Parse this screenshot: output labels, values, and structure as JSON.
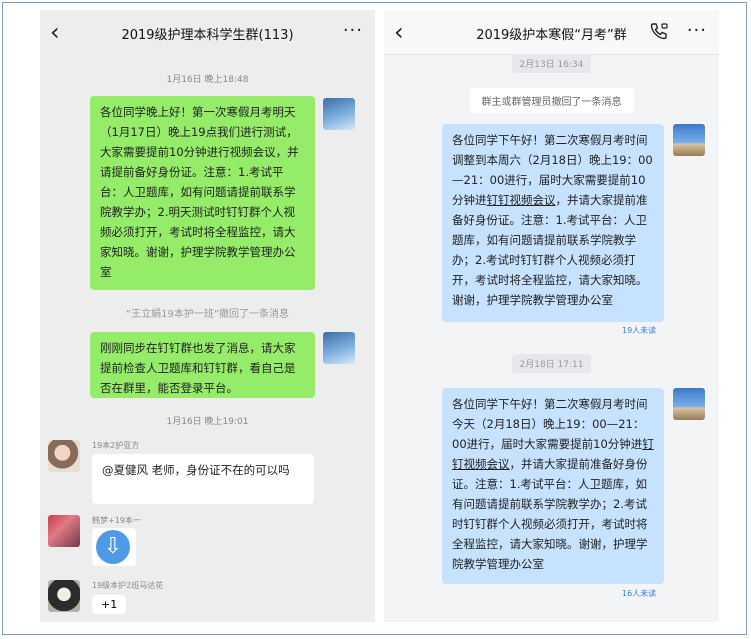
{
  "left": {
    "title": "2019级护理本科学生群(113)",
    "time1": "1月16日 晚上18:48",
    "msg1": "各位同学晚上好！第一次寒假月考明天（1月17日）晚上19点我们进行测试，大家需要提前10分钟进行视频会议，并请提前备好身份证。注意：1.考试平台：人卫题库，如有问题请提前联系学院教学办；2.明天测试时钉钉群个人视频必须打开，考试时将全程监控，请大家知晓。谢谢，护理学院教学管理办公室",
    "recall": "“王立娟19本护一班”撤回了一条消息",
    "msg2": "刚刚同步在钉钉群也发了消息，请大家提前检查人卫题库和钉钉群，看自己是否在群里，能否登录平台。",
    "time2": "1月16日 晚上19:01",
    "sender1": "19本2护亚方",
    "msg3": "@夏健风 老师，身份证不在的可以吗",
    "sender2": "韩梦+19本一",
    "sender3": "19级本护2班马达花",
    "msg4": "+1"
  },
  "right": {
    "title": "2019级护本寒假“月考”群",
    "time1": "2月13日 16:34",
    "sys": "群主或群管理员撤回了一条消息",
    "msg1": {
      "before": "各位同学下午好！第二次寒假月考时间调整到本周六（2月18日）晚上19：00—21：00进行，届时大家需要提前10分钟进",
      "link": "钉钉视频会议",
      "after": "，并请大家提前准备好身份证。注意：1.考试平台：人卫题库，如有问题请提前联系学院教学办；2.考试时钉钉群个人视频必须打开，考试时将全程监控，请大家知晓。谢谢，护理学院教学管理办公室"
    },
    "read1": "19人未读",
    "time2": "2月18日 17:11",
    "msg2": {
      "before": "各位同学下午好！第二次寒假月考时间今天（2月18日）晚上19：00—21：00进行，届时大家需要提前10分钟进",
      "link": "钉钉视频会议",
      "after": "，并请大家提前准备好身份证。注意：1.考试平台：人卫题库，如有问题请提前联系学院教学办；2.考试时钉钉群个人视频必须打开，考试时将全程监控，请大家知晓。谢谢，护理学院教学管理办公室"
    },
    "read2": "16人未读"
  }
}
